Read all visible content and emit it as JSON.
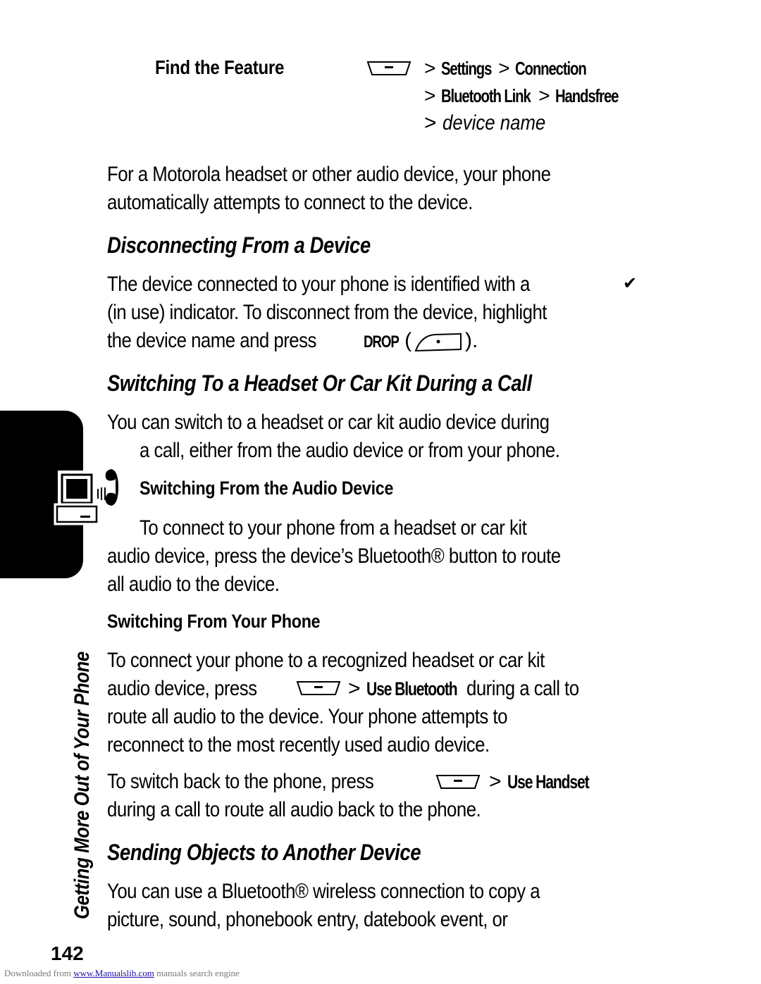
{
  "find_feature": {
    "label": "Find the Feature",
    "icon": "menu-key-icon",
    "path_line1": [
      {
        "sep": ">",
        "item": "Settings"
      },
      {
        "sep": ">",
        "item": "Connection"
      }
    ],
    "path_line2": [
      {
        "sep": ">",
        "item": "Bluetooth Link"
      },
      {
        "sep": ">",
        "item": "Handsfree"
      }
    ],
    "path_line3": {
      "sep": ">",
      "item": "device name"
    }
  },
  "intro": {
    "line1": "For a Motorola headset or other audio device, your phone",
    "line2": "automatically attempts to connect to the device."
  },
  "disconnecting": {
    "heading": "Disconnecting From a Device",
    "line1": "The device connected to your phone is identified with a",
    "checkmark": "✔",
    "line2": "(in use) indicator. To disconnect from the device, highlight",
    "line3_pre": "the device name and press",
    "key_label": "DROP",
    "paren_open": "(",
    "paren_close": ")."
  },
  "switching": {
    "heading": "Switching To a Headset Or Car Kit During a Call",
    "line1": "You can switch to a headset or car kit audio device during",
    "line2": "a call, either from the audio device or from your phone."
  },
  "from_audio_device": {
    "heading": "Switching From the Audio Device",
    "line1": "To connect to your phone from a headset or car kit",
    "line2": "audio device, press the device’s Bluetooth® button to route",
    "line3": "all audio to the device."
  },
  "from_phone": {
    "heading": "Switching From Your Phone",
    "p1_line1": "To connect your phone to a recognized headset or car kit",
    "p1_line2_pre": "audio device, press",
    "p1_sep": ">",
    "p1_item": "Use Bluetooth",
    "p1_line2_post": "during a call to",
    "p1_line3": "route all audio to the device. Your phone attempts to",
    "p1_line4": "reconnect to the most recently used audio device.",
    "p2_line1_pre": "To switch back to the phone, press",
    "p2_sep": ">",
    "p2_item": "Use Handset",
    "p2_line2": "during a call to route all audio back to the phone."
  },
  "sending": {
    "heading": "Sending Objects to Another Device",
    "line1": "You can use a Bluetooth® wireless connection to copy a",
    "line2": "picture, sound, phonebook entry, datebook event, or"
  },
  "sidebar": {
    "section_label": "Getting More Out of Your Phone",
    "tab_icon": "computer-phone-icon"
  },
  "page_number": "142",
  "footer": {
    "pre": "Downloaded from",
    "link": "www.Manualslib.com",
    "post": "manuals search engine",
    "link_color": "#1a0dab"
  }
}
